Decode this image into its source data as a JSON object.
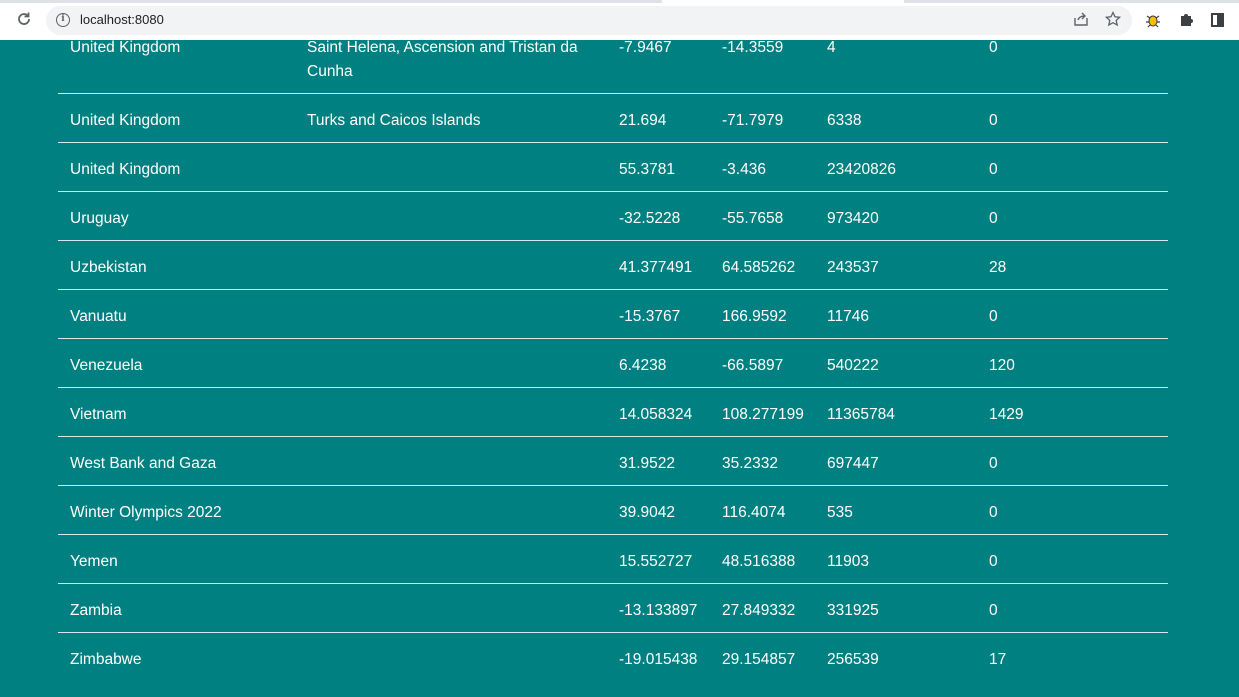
{
  "browser": {
    "url": "localhost:8080",
    "reload_icon": "reload-icon",
    "info_icon": "info-icon",
    "share_icon": "share-icon",
    "star_icon": "star-icon",
    "extension_icon": "bug-extension-icon",
    "puzzle_icon": "puzzle-icon",
    "sidepanel_icon": "side-panel-icon"
  },
  "rows": [
    {
      "country": "United Kingdom",
      "province": "Saint Helena, Ascension and Tristan da Cunha",
      "lat": "-7.9467",
      "lon": "-14.3559",
      "confirmed": "4",
      "deaths": "0"
    },
    {
      "country": "United Kingdom",
      "province": "Turks and Caicos Islands",
      "lat": "21.694",
      "lon": "-71.7979",
      "confirmed": "6338",
      "deaths": "0"
    },
    {
      "country": "United Kingdom",
      "province": "",
      "lat": "55.3781",
      "lon": "-3.436",
      "confirmed": "23420826",
      "deaths": "0"
    },
    {
      "country": "Uruguay",
      "province": "",
      "lat": "-32.5228",
      "lon": "-55.7658",
      "confirmed": "973420",
      "deaths": "0"
    },
    {
      "country": "Uzbekistan",
      "province": "",
      "lat": "41.377491",
      "lon": "64.585262",
      "confirmed": "243537",
      "deaths": "28"
    },
    {
      "country": "Vanuatu",
      "province": "",
      "lat": "-15.3767",
      "lon": "166.9592",
      "confirmed": "11746",
      "deaths": "0"
    },
    {
      "country": "Venezuela",
      "province": "",
      "lat": "6.4238",
      "lon": "-66.5897",
      "confirmed": "540222",
      "deaths": "120"
    },
    {
      "country": "Vietnam",
      "province": "",
      "lat": "14.058324",
      "lon": "108.277199",
      "confirmed": "11365784",
      "deaths": "1429"
    },
    {
      "country": "West Bank and Gaza",
      "province": "",
      "lat": "31.9522",
      "lon": "35.2332",
      "confirmed": "697447",
      "deaths": "0"
    },
    {
      "country": "Winter Olympics 2022",
      "province": "",
      "lat": "39.9042",
      "lon": "116.4074",
      "confirmed": "535",
      "deaths": "0"
    },
    {
      "country": "Yemen",
      "province": "",
      "lat": "15.552727",
      "lon": "48.516388",
      "confirmed": "11903",
      "deaths": "0"
    },
    {
      "country": "Zambia",
      "province": "",
      "lat": "-13.133897",
      "lon": "27.849332",
      "confirmed": "331925",
      "deaths": "0"
    },
    {
      "country": "Zimbabwe",
      "province": "",
      "lat": "-19.015438",
      "lon": "29.154857",
      "confirmed": "256539",
      "deaths": "17"
    }
  ]
}
